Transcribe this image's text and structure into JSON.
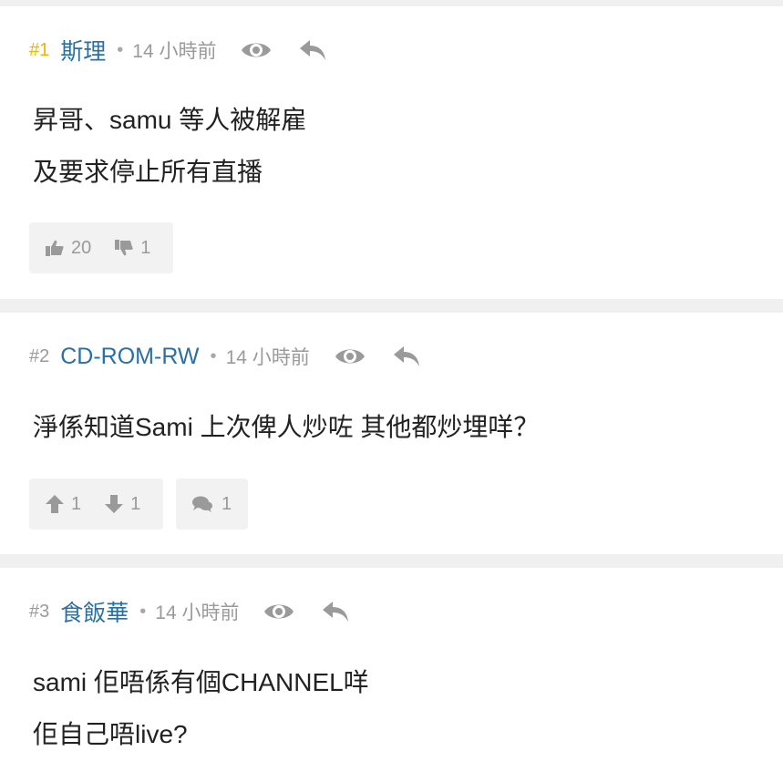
{
  "colors": {
    "background": "#f0f0f0",
    "card": "#ffffff",
    "username": "#2b6fa3",
    "op_number": "#f2b400",
    "meta": "#9a9a9a",
    "button_bg": "#f2f2f2"
  },
  "posts": [
    {
      "number": "#1",
      "is_op": true,
      "username": "斯理",
      "separator": "•",
      "time": "14 小時前",
      "body": [
        "昇哥、samu 等人被解雇",
        "及要求停止所有直播"
      ],
      "votes": {
        "up_icon": "thumbs-up-icon",
        "up": "20",
        "down_icon": "thumbs-down-icon",
        "down": "1"
      }
    },
    {
      "number": "#2",
      "is_op": false,
      "username": "CD-ROM-RW",
      "separator": "•",
      "time": "14 小時前",
      "body": [
        "淨係知道Sami 上次俾人炒咗 其他都炒埋咩？"
      ],
      "votes": {
        "up_icon": "arrow-up-icon",
        "up": "1",
        "down_icon": "arrow-down-icon",
        "down": "1"
      },
      "replies": {
        "icon": "comments-icon",
        "count": "1"
      }
    },
    {
      "number": "#3",
      "is_op": false,
      "username": "食飯華",
      "separator": "•",
      "time": "14 小時前",
      "body": [
        "sami 佢唔係有個CHANNEL咩",
        "佢自己唔live?"
      ]
    }
  ]
}
